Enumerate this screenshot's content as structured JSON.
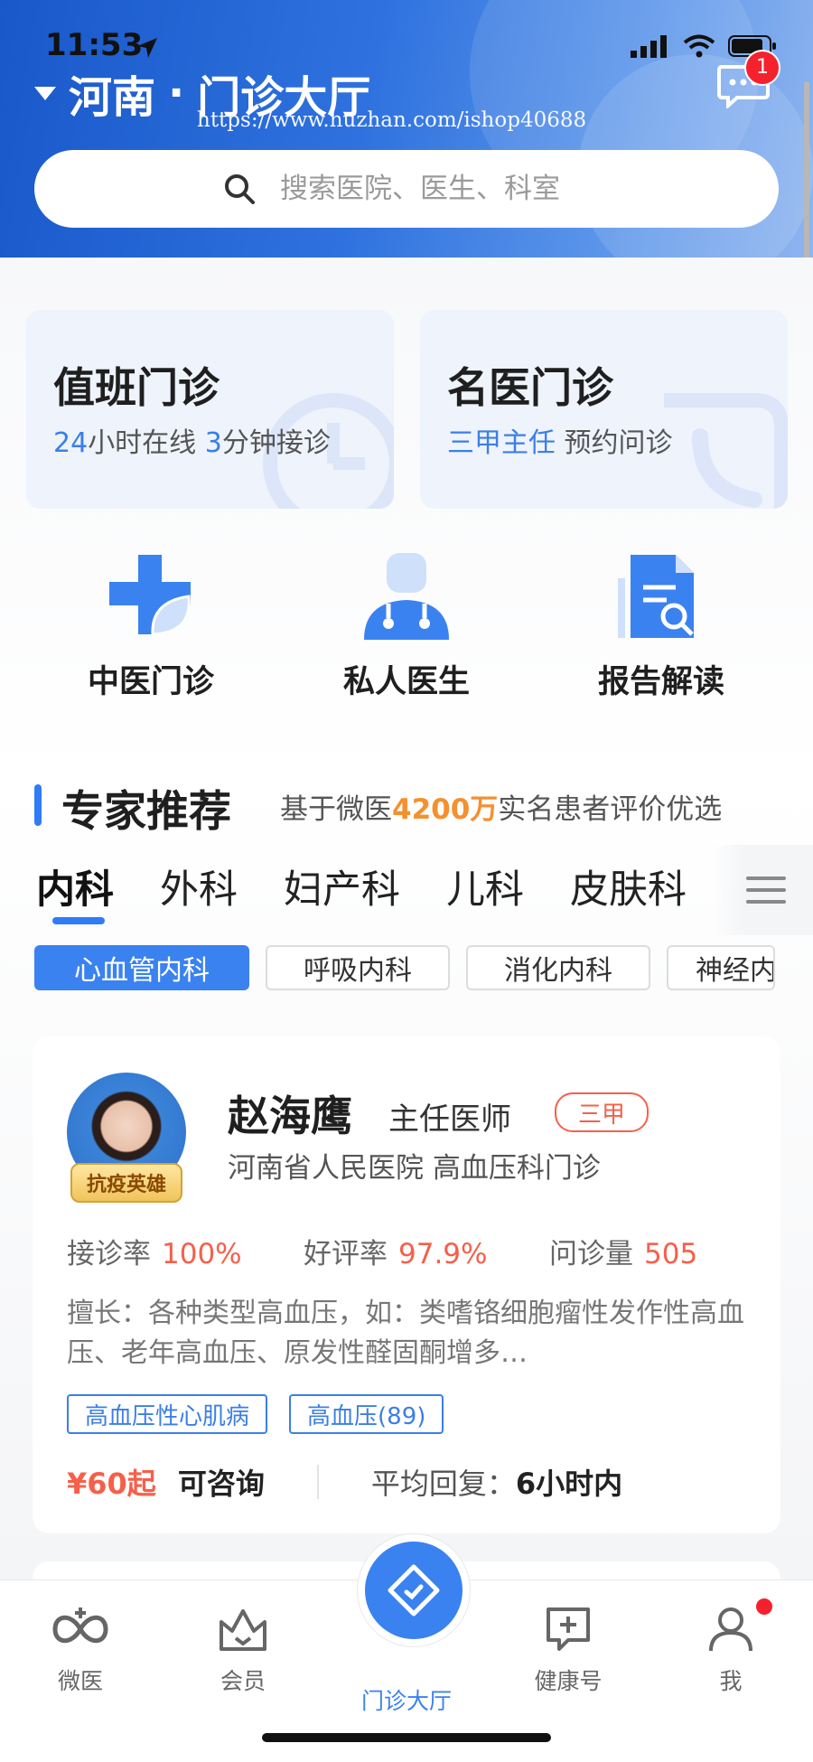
{
  "status": {
    "time": "11:53"
  },
  "header": {
    "city": "河南",
    "title": "门诊大厅",
    "separator": "·",
    "watermark": "https://www.huzhan.com/ishop40688",
    "message_badge": "1"
  },
  "search": {
    "placeholder": "搜索医院、医生、科室"
  },
  "top_cards": [
    {
      "title": "值班门诊",
      "sub_a": "24",
      "sub_b": "小时在线 ",
      "sub_c": "3",
      "sub_d": "分钟接诊"
    },
    {
      "title": "名医门诊",
      "sub_blue": "三甲主任",
      "sub_rest": "  预约问诊"
    }
  ],
  "grid": [
    {
      "label": "中医门诊",
      "icon": "tcm-cross-leaf-icon"
    },
    {
      "label": "私人医生",
      "icon": "doctor-stethoscope-icon"
    },
    {
      "label": "报告解读",
      "icon": "report-search-icon"
    }
  ],
  "section": {
    "title": "专家推荐",
    "sub_pre": "基于微医",
    "sub_num": "4200万",
    "sub_post": "实名患者评价优选"
  },
  "tabs": [
    "内科",
    "外科",
    "妇产科",
    "儿科",
    "皮肤科"
  ],
  "chips": [
    "心血管内科",
    "呼吸内科",
    "消化内科",
    "神经内"
  ],
  "doctor": {
    "badge": "抗疫英雄",
    "name": "赵海鹰",
    "title": "主任医师",
    "level": "三甲",
    "hospital": "河南省人民医院 高血压科门诊",
    "stats": [
      {
        "label": "接诊率",
        "value": "100%"
      },
      {
        "label": "好评率",
        "value": "97.9%"
      },
      {
        "label": "问诊量",
        "value": "505"
      }
    ],
    "skill": "擅长：各种类型高血压，如：类嗜铬细胞瘤性发作性高血压、老年高血压、原发性醛固酮增多…",
    "tags": [
      "高血压性心肌病",
      "高血压(89)"
    ],
    "price": "¥60起",
    "consult": "可咨询",
    "reply_label": "平均回复：",
    "reply_value": "6小时内"
  },
  "nav": [
    {
      "label": "微医",
      "icon": "weiyi-logo-icon"
    },
    {
      "label": "会员",
      "icon": "crown-icon"
    },
    {
      "label": "门诊大厅",
      "icon": "diamond-check-icon"
    },
    {
      "label": "健康号",
      "icon": "health-plus-message-icon"
    },
    {
      "label": "我",
      "icon": "user-icon"
    }
  ],
  "colors": {
    "primary": "#3a82f0",
    "accent_red": "#f5604b",
    "orange": "#f5902e"
  }
}
